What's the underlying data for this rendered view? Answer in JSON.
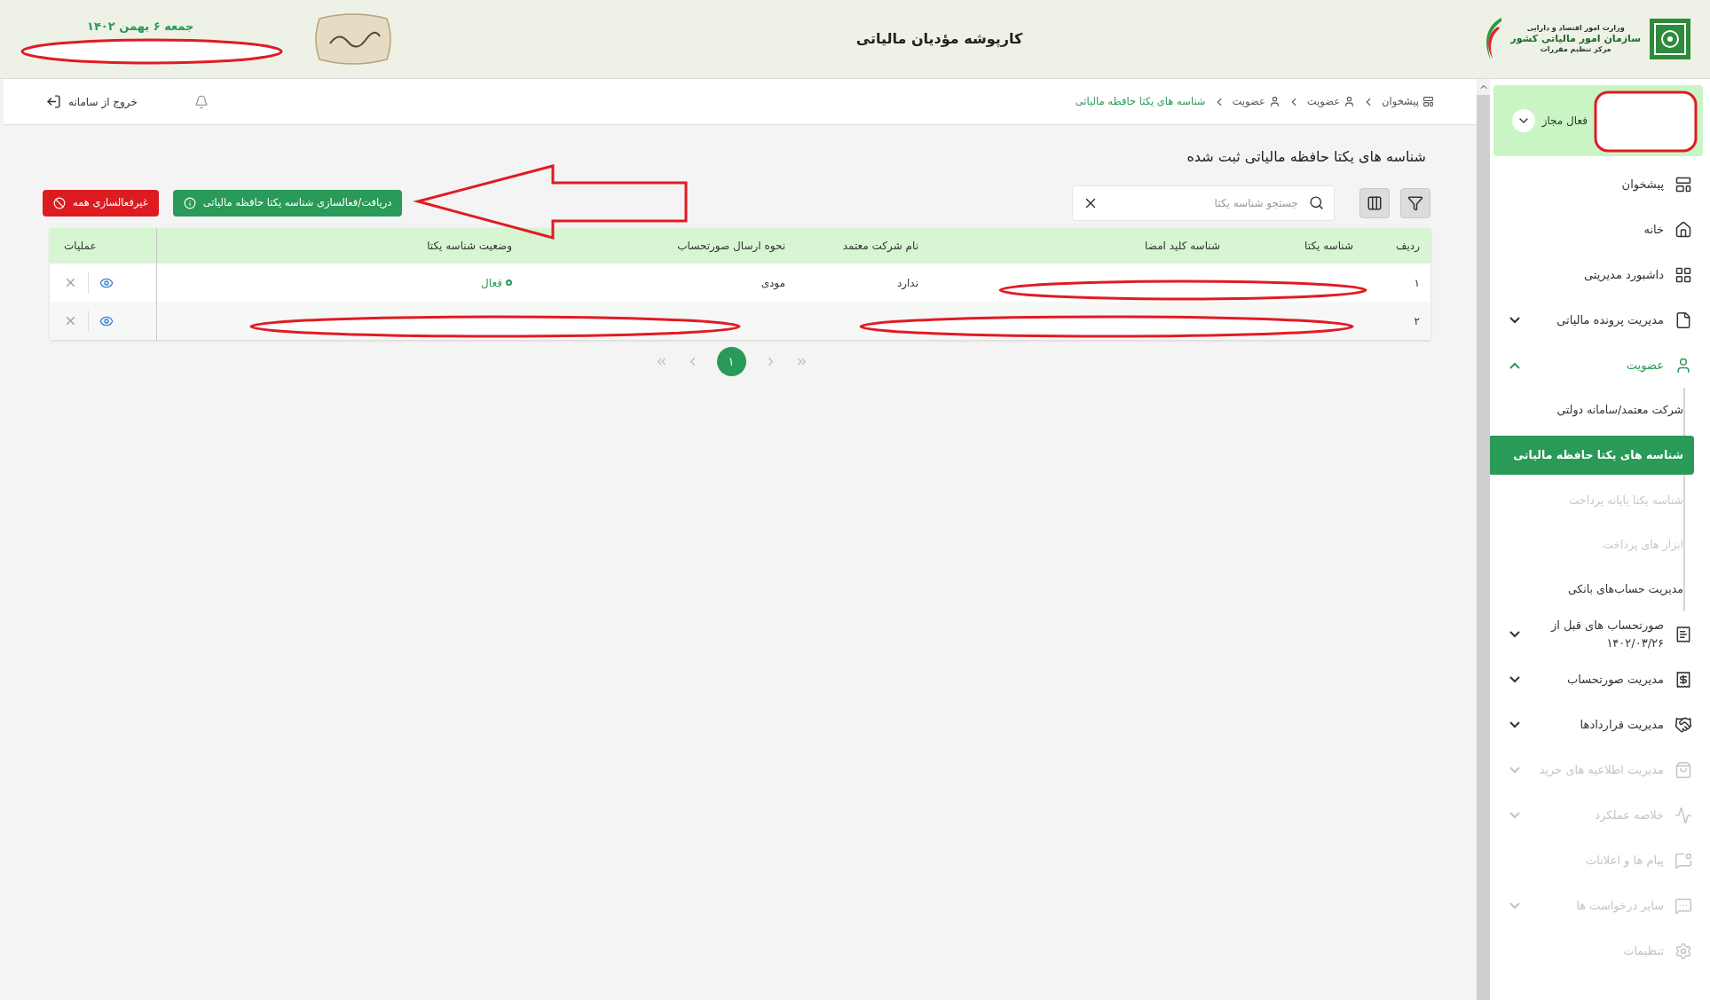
{
  "header": {
    "title": "کارپوشه مؤدیان مالیاتی",
    "date": "جمعه ۶ بهمن ۱۴۰۲",
    "logo_lines": [
      "وزارت امور اقتصاد و دارایی",
      "سازمان امور مالیاتی کشور",
      "مرکز تنظیم مقررات"
    ]
  },
  "user": {
    "status": "فعال مجاز"
  },
  "sidebar": {
    "items": [
      {
        "kind": "link",
        "label": "پیشخوان",
        "disabled": false
      },
      {
        "kind": "link",
        "label": "خانه",
        "disabled": false
      },
      {
        "kind": "link",
        "label": "داشبورد مدیریتی",
        "disabled": false
      },
      {
        "kind": "group",
        "label": "مدیریت پرونده مالیاتی",
        "disabled": false,
        "expanded": false
      },
      {
        "kind": "group",
        "label": "عضویت",
        "disabled": false,
        "expanded": true,
        "children": [
          {
            "label": "شرکت معتمد/سامانه دولتی",
            "selected": false,
            "disabled": false
          },
          {
            "label": "شناسه های یکتا حافظه مالیاتی",
            "selected": true,
            "disabled": false
          },
          {
            "label": "شناسه یکتا پایانه پرداخت",
            "selected": false,
            "disabled": true
          },
          {
            "label": "ابزار های پرداخت",
            "selected": false,
            "disabled": true
          },
          {
            "label": "مدیریت حساب‌های بانکی",
            "selected": false,
            "disabled": false
          }
        ]
      },
      {
        "kind": "group",
        "label": "صورتحساب های قبل از ۱۴۰۲/۰۳/۲۶",
        "disabled": false,
        "expanded": false
      },
      {
        "kind": "group",
        "label": "مدیریت صورتحساب",
        "disabled": false,
        "expanded": false
      },
      {
        "kind": "group",
        "label": "مدیریت قراردادها",
        "disabled": false,
        "expanded": false
      },
      {
        "kind": "group",
        "label": "مدیریت اطلاعیه های خرید",
        "disabled": true,
        "expanded": false
      },
      {
        "kind": "group",
        "label": "خلاصه عملکرد",
        "disabled": true,
        "expanded": false
      },
      {
        "kind": "link",
        "label": "پیام ها و اعلانات",
        "disabled": true
      },
      {
        "kind": "group",
        "label": "سایر درخواست ها",
        "disabled": true,
        "expanded": false
      },
      {
        "kind": "link",
        "label": "تنظیمات",
        "disabled": true
      }
    ]
  },
  "topbar": {
    "breadcrumbs": [
      {
        "label": "پیشخوان",
        "current": false
      },
      {
        "label": "عضویت",
        "current": false
      },
      {
        "label": "عضویت",
        "current": false
      },
      {
        "label": "شناسه های یکتا حافظه مالیاتی",
        "current": true
      }
    ],
    "logout": "خروج از سامانه"
  },
  "page": {
    "title": "شناسه های یکتا حافظه مالیاتی ثبت شده",
    "search": {
      "placeholder": "جستجو شناسه یکتا"
    },
    "buttons": [
      {
        "kind": "primary",
        "label": "دریافت/فعالسازی شناسه یکتا حافظه مالیاتی"
      },
      {
        "kind": "danger",
        "label": "غیرفعالسازی همه"
      }
    ]
  },
  "table": {
    "columns": [
      "ردیف",
      "شناسه یکتا",
      "شناسه کلید امضا",
      "نام شرکت معتمد",
      "نحوه ارسال صورتحساب",
      "وضعیت شناسه یکتا",
      "عملیات"
    ],
    "rows": [
      {
        "index": "۱",
        "company": "ندارد",
        "send_method": "مودی",
        "status": "فعال"
      },
      {
        "index": "۲"
      }
    ]
  },
  "pagination": {
    "pages": [
      {
        "label": "۱",
        "selected": true
      }
    ]
  }
}
